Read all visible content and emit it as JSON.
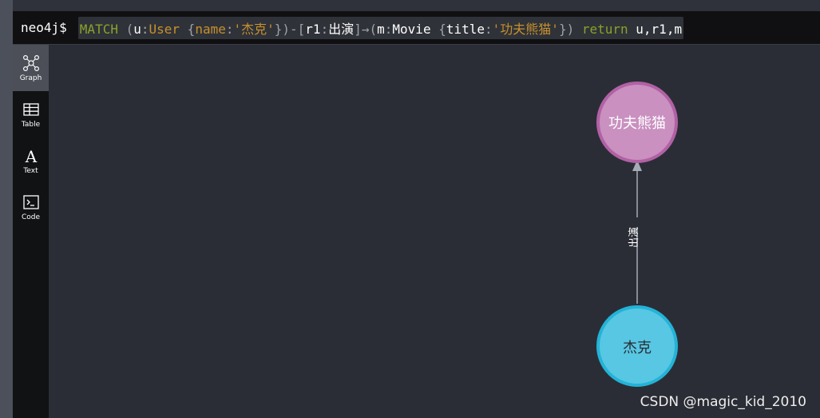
{
  "query": {
    "prompt": "neo4j$",
    "match_kw": "MATCH",
    "u_var": "u",
    "u_label": "User",
    "name_key": "name",
    "name_val": "'杰克'",
    "r_var": "r1",
    "r_type": "出演",
    "m_var": "m",
    "m_label": "Movie",
    "title_key": "title",
    "title_val": "'功夫熊猫'",
    "return_kw": "return",
    "return_vars": "u,r1,m"
  },
  "sidebar": {
    "items": [
      {
        "label": "Graph",
        "icon": "graph-icon",
        "active": true
      },
      {
        "label": "Table",
        "icon": "table-icon",
        "active": false
      },
      {
        "label": "Text",
        "icon": "text-icon",
        "active": false
      },
      {
        "label": "Code",
        "icon": "code-icon",
        "active": false
      }
    ]
  },
  "graph": {
    "movie_node": {
      "caption": "功夫熊猫",
      "color": "#c990c0",
      "border": "#b261a5"
    },
    "user_node": {
      "caption": "杰克",
      "color": "#57c7e3",
      "border": "#23b3d7"
    },
    "relationship": {
      "caption": "出演",
      "color": "#a5abb6"
    }
  },
  "watermark": "CSDN @magic_kid_2010"
}
